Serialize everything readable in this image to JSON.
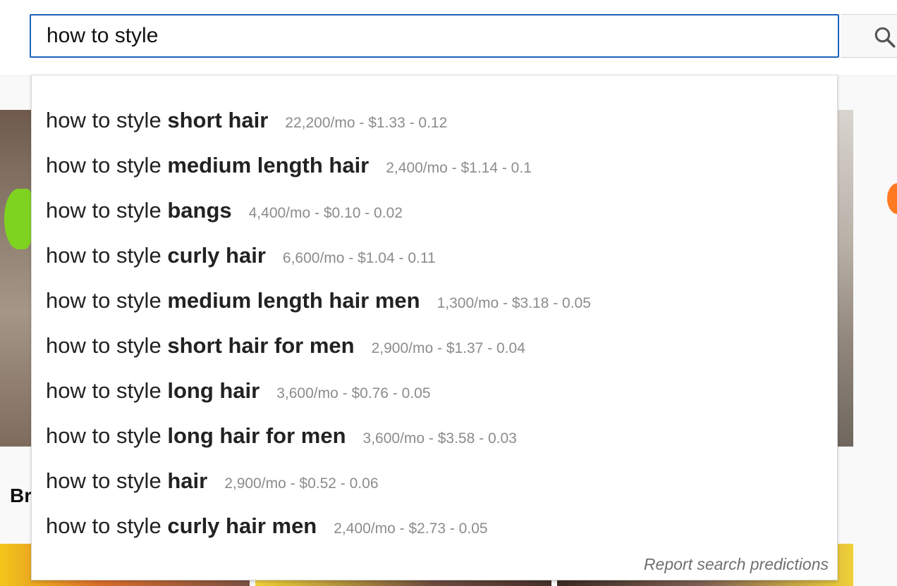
{
  "search": {
    "query": "how to style"
  },
  "background": {
    "section_title_partial": "Br"
  },
  "suggestions": [
    {
      "prefix": "how to style",
      "completion": "short hair",
      "stats": "22,200/mo - $1.33 - 0.12"
    },
    {
      "prefix": "how to style",
      "completion": "medium length hair",
      "stats": "2,400/mo - $1.14 - 0.1"
    },
    {
      "prefix": "how to style",
      "completion": "bangs",
      "stats": "4,400/mo - $0.10 - 0.02"
    },
    {
      "prefix": "how to style",
      "completion": "curly hair",
      "stats": "6,600/mo - $1.04 - 0.11"
    },
    {
      "prefix": "how to style",
      "completion": "medium length hair men",
      "stats": "1,300/mo - $3.18 - 0.05"
    },
    {
      "prefix": "how to style",
      "completion": "short hair for men",
      "stats": "2,900/mo - $1.37 - 0.04"
    },
    {
      "prefix": "how to style",
      "completion": "long hair",
      "stats": "3,600/mo - $0.76 - 0.05"
    },
    {
      "prefix": "how to style",
      "completion": "long hair for men",
      "stats": "3,600/mo - $3.58 - 0.03"
    },
    {
      "prefix": "how to style",
      "completion": "hair",
      "stats": "2,900/mo - $0.52 - 0.06"
    },
    {
      "prefix": "how to style",
      "completion": "curly hair men",
      "stats": "2,400/mo - $2.73 - 0.05"
    }
  ],
  "report_link": "Report search predictions",
  "icons": {
    "search_button": "search-icon"
  },
  "colors": {
    "input_border": "#1c62b9",
    "stats_text": "#8c8c8c"
  }
}
